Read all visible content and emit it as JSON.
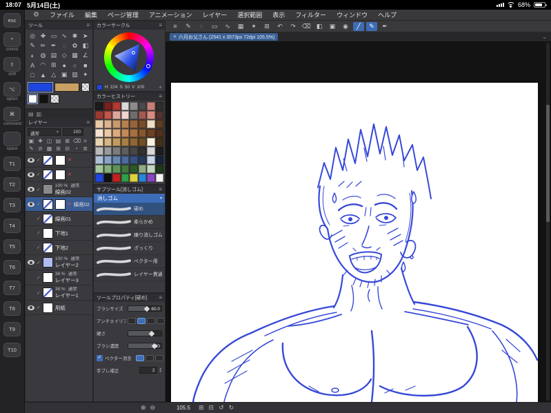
{
  "statusbar": {
    "time": "18:07",
    "date": "5月14日(土)",
    "battery": "68%"
  },
  "menubar": {
    "items": [
      "ファイル",
      "編集",
      "ページ管理",
      "アニメーション",
      "レイヤー",
      "選択範囲",
      "表示",
      "フィルター",
      "ウィンドウ",
      "ヘルプ"
    ]
  },
  "edge": {
    "modifiers": [
      {
        "sym": "esc",
        "label": ""
      },
      {
        "sym": "^",
        "label": "control"
      },
      {
        "sym": "⇧",
        "label": "shift"
      },
      {
        "sym": "⌥",
        "label": "option"
      },
      {
        "sym": "⌘",
        "label": "command"
      },
      {
        "sym": " ",
        "label": "space"
      }
    ],
    "tkeys": [
      "T1",
      "T2",
      "T3",
      "T4",
      "T5",
      "T6",
      "T7",
      "T8",
      "T9",
      "T10"
    ]
  },
  "tool_panel": {
    "title": "ツール"
  },
  "tools": [
    "◎",
    "✚",
    "▭",
    "∿",
    "✱",
    "➤",
    "✎",
    "✏",
    "✒",
    "◌",
    "✿",
    "◧",
    "◐",
    "◍",
    "▤",
    "◇",
    "▦",
    "∠",
    "A",
    "◠",
    "⊞",
    "●",
    "○",
    "■",
    "□",
    "▲",
    "△",
    "▣",
    "▥",
    "✦"
  ],
  "colors": {
    "primary": "#1e46e0",
    "secondary": "#c9a063"
  },
  "color_circle": {
    "title": "カラーサークル",
    "h_label": "H",
    "h": "224",
    "s_label": "S",
    "s": "50",
    "v_label": "V",
    "v": "100",
    "add": "+"
  },
  "color_history": {
    "title": "カラーヒストリー",
    "swatches": [
      "#1b1b1b",
      "#7a1f1f",
      "#b23a2e",
      "#d9d9d9",
      "#8c8c8c",
      "#4a4a4a",
      "#c97f76",
      "#2e2e2e",
      "#9c3a30",
      "#c0564a",
      "#e0a69e",
      "#f0d4cf",
      "#6e6e6e",
      "#a35a50",
      "#d88c80",
      "#553030",
      "#e8c9a8",
      "#dcb48e",
      "#c99a6e",
      "#b5804f",
      "#96653a",
      "#7a4e2b",
      "#f0ddc4",
      "#5e3d22",
      "#f5e3d0",
      "#ecc9a6",
      "#dba97c",
      "#c48a58",
      "#a86f40",
      "#8a562e",
      "#6e4220",
      "#52301a",
      "#e9d3b0",
      "#d6b684",
      "#c29a5e",
      "#a87f44",
      "#8d6632",
      "#715026",
      "#fdf2e0",
      "#443018",
      "#b9b9b9",
      "#9a9a9a",
      "#7c7c7c",
      "#5e5e5e",
      "#464646",
      "#303030",
      "#d8d8d8",
      "#1e1e1e",
      "#aebfd8",
      "#8aa3c8",
      "#6787b4",
      "#4a6b9c",
      "#35517e",
      "#263a5c",
      "#c8d6e8",
      "#18243a",
      "#a8c8a0",
      "#84b07a",
      "#5f9457",
      "#43763c",
      "#2e5829",
      "#8fae86",
      "#c4d8be",
      "#1d3a1a",
      "#1e46e0",
      "#101010",
      "#c22222",
      "#2aa04a",
      "#e0d040",
      "#2a86d8",
      "#8a46c0",
      "#f5f5f5"
    ]
  },
  "layer_panel": {
    "title": "レイヤー",
    "blend": "通常",
    "opacity": "100",
    "icons_a": [
      "▣",
      "✚",
      "◫",
      "▤",
      "⊠",
      "⌫",
      "≡"
    ],
    "icons_b": [
      "✎",
      "⊘",
      "▩",
      "⊞",
      "⊟",
      "◔",
      "≣"
    ],
    "layers": [
      {
        "thumb1": "sketch",
        "thumb2": "checker",
        "red": true,
        "name": "",
        "eye": true
      },
      {
        "thumb1": "sketch",
        "thumb2": "checker",
        "red": true,
        "name": "",
        "eye": true
      },
      {
        "thumb1": "folder",
        "opacity": "100 %",
        "blend": "通常",
        "name": "線画02",
        "folder": true,
        "eye": true
      },
      {
        "thumb1": "sketch",
        "thumb2": "checker",
        "red": true,
        "name": "線画02",
        "selected": true,
        "eye": true
      },
      {
        "thumb1": "sketch",
        "name": "線画01",
        "eye": false
      },
      {
        "thumb1": "checker",
        "name": "下地1",
        "eye": false
      },
      {
        "thumb1": "sketch",
        "name": "下地2",
        "eye": false
      },
      {
        "thumb1": "bluefill",
        "opacity": "100 %",
        "blend": "通常",
        "name": "レイヤー2",
        "eye": true
      },
      {
        "thumb1": "checker",
        "opacity": "38 %",
        "blend": "通常",
        "name": "レイヤー3",
        "eye": false
      },
      {
        "thumb1": "sketch",
        "opacity": "38 %",
        "blend": "通常",
        "name": "レイヤー1",
        "eye": false
      },
      {
        "thumb1": "whitefill",
        "name": "用紙",
        "eye": true
      }
    ]
  },
  "subtool": {
    "title": "サブツール[消しゴム]",
    "group": "消しゴム",
    "items": [
      {
        "name": "硬め",
        "selected": true
      },
      {
        "name": "柔らかめ"
      },
      {
        "name": "練り消しゴム"
      },
      {
        "name": "ざっくり"
      },
      {
        "name": "ベクター用"
      },
      {
        "name": "レイヤー貫通"
      }
    ]
  },
  "toolprop": {
    "title": "ツールプロパティ[硬め]",
    "rows": [
      {
        "label": "ブラシサイズ",
        "value": "60.0"
      },
      {
        "label": "アンチエイリアス"
      },
      {
        "label": "硬さ"
      },
      {
        "label": "ブラシ濃度",
        "value": "80"
      },
      {
        "label": "ベクター消去"
      },
      {
        "label": "手ブレ補正",
        "value": "2"
      }
    ]
  },
  "canvas": {
    "toolbar": [
      {
        "g": "≡"
      },
      {
        "g": "✎"
      },
      {
        "g": "◌"
      },
      {
        "g": "▭"
      },
      {
        "g": "∿"
      },
      {
        "g": "▦"
      },
      {
        "g": "✦"
      },
      {
        "g": "⊞"
      },
      {
        "g": "↶"
      },
      {
        "g": "↷"
      },
      {
        "g": "⌫"
      },
      {
        "g": "◧"
      },
      {
        "g": "▣"
      },
      {
        "g": "◉"
      },
      {
        "g": "╱",
        "active": true
      },
      {
        "g": "✎",
        "active": true
      },
      {
        "g": "✒"
      }
    ],
    "tab_close": "✕",
    "tab_title": "六月お父さん (2541 x 3573px 72dpi 105.5%)",
    "tab_caret": "⌄"
  },
  "bottombar": {
    "panel_icons": [
      "⊕",
      "⊖"
    ],
    "zoom": "105.5",
    "view_icons": [
      "⊞",
      "⊟",
      "↺",
      "↻"
    ]
  }
}
